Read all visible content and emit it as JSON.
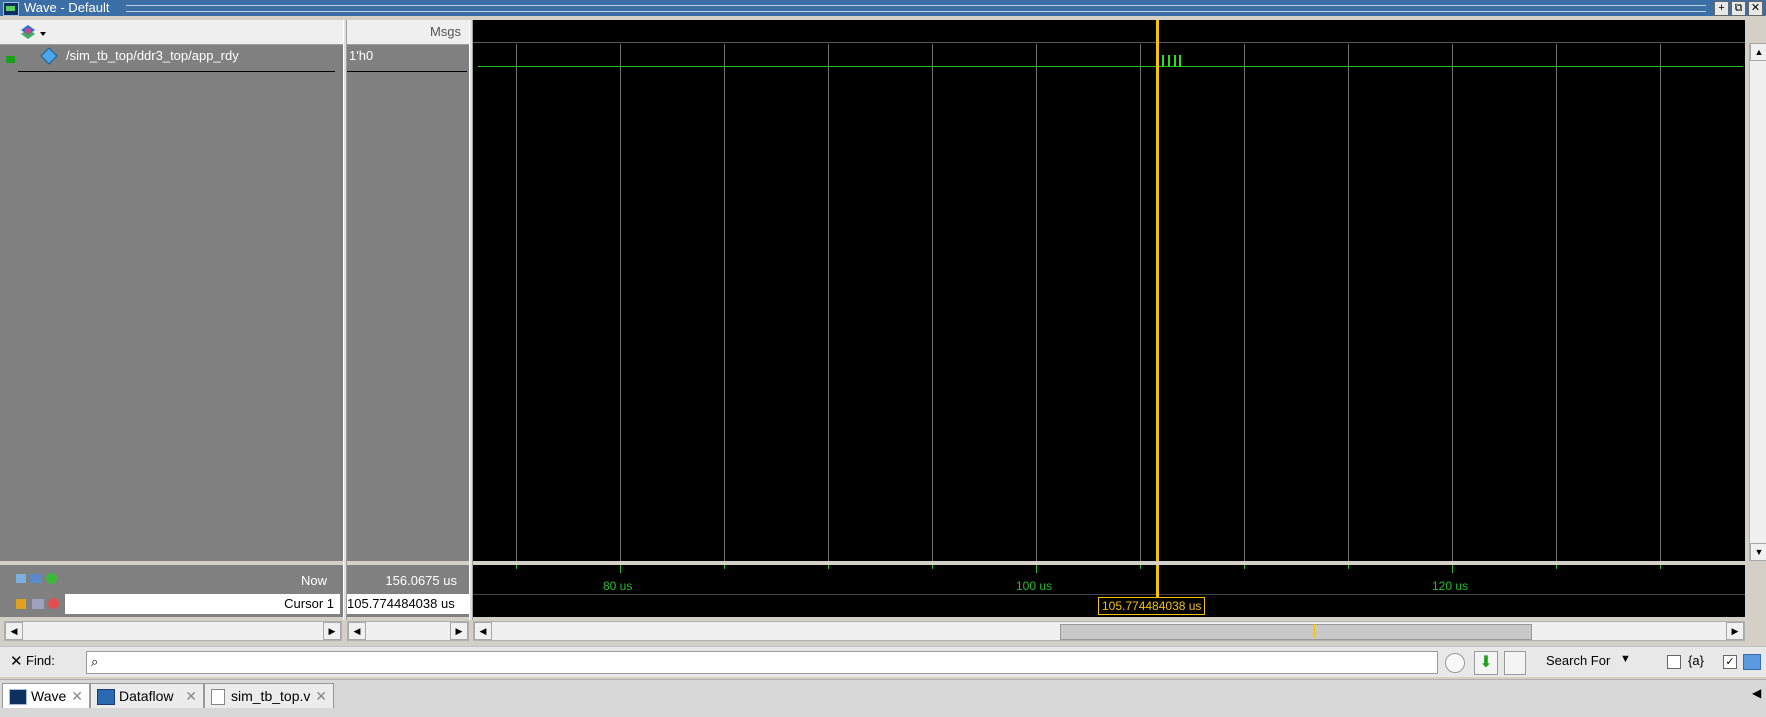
{
  "window": {
    "title": "Wave - Default"
  },
  "names_pane": {
    "signals": [
      {
        "path": "/sim_tb_top/ddr3_top/app_rdy",
        "value": "1'h0"
      }
    ]
  },
  "values_pane": {
    "header": "Msgs"
  },
  "status": {
    "now_label": "Now",
    "now_value": "156.0675 us",
    "cursor_label": "Cursor 1",
    "cursor_value": "105.774484038 us"
  },
  "timeline": {
    "labels": [
      "80 us",
      "100 us",
      "120 us"
    ],
    "cursor_tag": "105.774484038 us"
  },
  "find_bar": {
    "find_label": "Find:",
    "search_for": "Search For",
    "regex_label": "{a}"
  },
  "tabs": [
    {
      "label": "Wave"
    },
    {
      "label": "Dataflow"
    },
    {
      "label": "sim_tb_top.v"
    }
  ],
  "colors": {
    "wave_bg": "#000000",
    "signal": "#22c022",
    "cursor": "#f5c400",
    "pane_gray": "#808080"
  }
}
